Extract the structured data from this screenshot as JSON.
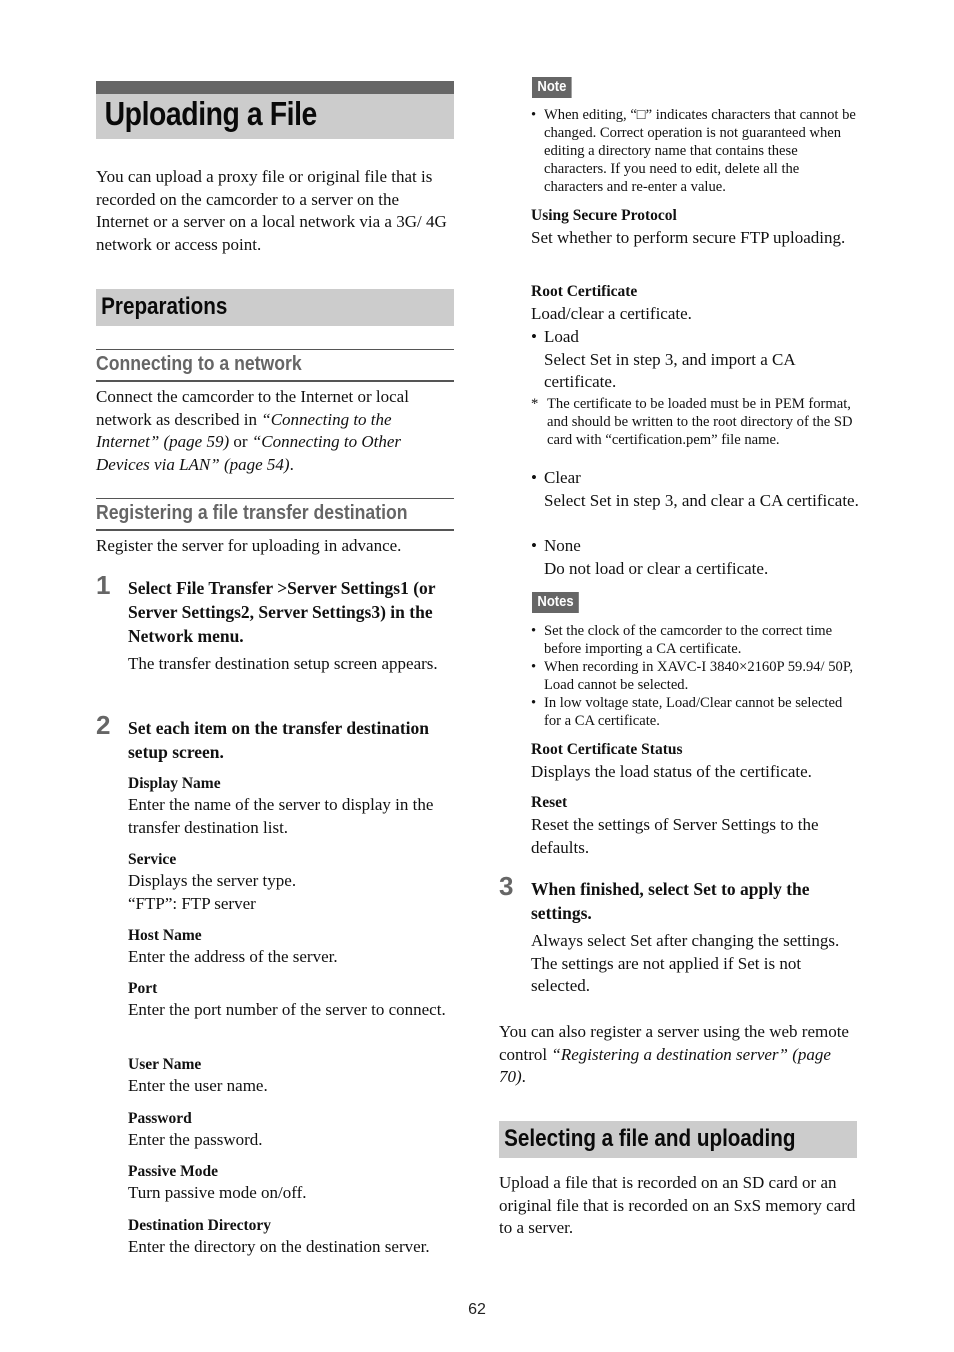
{
  "page": {
    "title": "Uploading a File",
    "intro": "You can upload a proxy file or original file that is recorded on the camcorder to a server on the Internet or a server on a local network via a 3G/ 4G network or access point.",
    "page_number": "62"
  },
  "preparations": {
    "heading": "Preparations",
    "connecting": {
      "heading": "Connecting to a network",
      "text_1": "Connect the camcorder to the Internet or local network as described in ",
      "link_1": "“Connecting to the Internet” (page 59)",
      "text_2": " or ",
      "link_2": "“Connecting to Other Devices via LAN” (page 54)",
      "text_3": "."
    },
    "registering": {
      "heading": "Registering a file transfer destination",
      "intro": "Register the server for uploading in advance."
    }
  },
  "steps": [
    {
      "number": "1",
      "title": "Select File Transfer >Server Settings1 (or Server Settings2, Server Settings3) in the Network menu.",
      "body": "The transfer destination setup screen appears."
    },
    {
      "number": "2",
      "title": "Set each item on the transfer destination setup screen.",
      "items": [
        {
          "label": "Display Name",
          "desc": "Enter the name of the server to display in the transfer destination list."
        },
        {
          "label": "Service",
          "desc": "Displays the server type.",
          "desc2": "“FTP”: FTP server"
        },
        {
          "label": "Host Name",
          "desc": "Enter the address of the server."
        },
        {
          "label": "Port",
          "desc": "Enter the port number of the server to connect."
        },
        {
          "label": "User Name",
          "desc": "Enter the user name."
        },
        {
          "label": "Password",
          "desc": "Enter the password."
        },
        {
          "label": "Passive Mode",
          "desc": "Turn passive mode on/off."
        },
        {
          "label": "Destination Directory",
          "desc": "Enter the directory on the destination server."
        }
      ]
    },
    {
      "number": "3",
      "title": "When finished, select Set to apply the settings.",
      "body": "Always select Set after changing the settings. The settings are not applied if Set is not selected."
    }
  ],
  "note": {
    "tag": "Note",
    "items": [
      "When editing, “□” indicates characters that cannot be changed. Correct operation is not guaranteed when editing a directory name that contains these characters. If you need to edit, delete all the characters and re-enter a value."
    ]
  },
  "secure_protocol": {
    "label": "Using Secure Protocol",
    "desc": "Set whether to perform secure FTP uploading."
  },
  "root_certificate": {
    "label": "Root Certificate",
    "desc": "Load/clear a certificate.",
    "options": [
      {
        "name": "Load",
        "desc": "Select Set in step 3, and import a CA certificate."
      },
      {
        "name": "Clear",
        "desc": "Select Set in step 3, and clear a CA certificate."
      },
      {
        "name": "None",
        "desc": "Do not load or clear a certificate."
      }
    ],
    "footnote_mark": "*",
    "footnote": "The certificate to be loaded must be in PEM format, and should be written to the root directory of the SD card with “certification.pem” file name."
  },
  "notes": {
    "tag": "Notes",
    "items": [
      "Set the clock of the camcorder to the correct time before importing a CA certificate.",
      "When recording in XAVC-I 3840×2160P 59.94/ 50P, Load cannot be selected.",
      "In low voltage state, Load/Clear cannot be selected for a CA certificate."
    ]
  },
  "root_certificate_status": {
    "label": "Root Certificate Status",
    "desc": "Displays the load status of the certificate."
  },
  "reset": {
    "label": "Reset",
    "desc": "Reset the settings of Server Settings to the defaults."
  },
  "web_remote": {
    "text_1": "You can also register a server using the web remote control ",
    "link": "“Registering a destination server” (page 70)",
    "text_2": "."
  },
  "selecting": {
    "heading": "Selecting a file and uploading",
    "text": "Upload a file that is recorded on an SD card or an original file that is recorded on an SxS memory card to a server."
  }
}
